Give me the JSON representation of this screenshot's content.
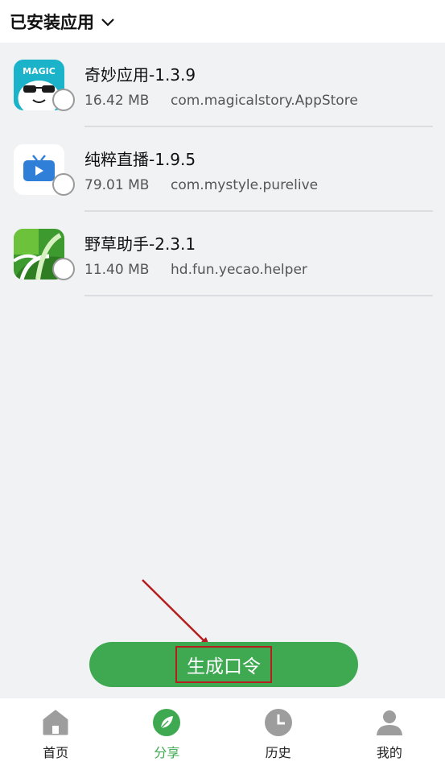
{
  "header": {
    "title": "已安装应用",
    "chevron_icon": "chevron-down-icon"
  },
  "apps": [
    {
      "name": "奇妙应用-1.3.9",
      "size": "16.42 MB",
      "package": "com.magicalstory.AppStore",
      "icon_text": "MAGIC"
    },
    {
      "name": "纯粹直播-1.9.5",
      "size": "79.01 MB",
      "package": "com.mystyle.purelive"
    },
    {
      "name": "野草助手-2.3.1",
      "size": "11.40 MB",
      "package": "hd.fun.yecao.helper"
    }
  ],
  "action": {
    "label": "生成口令"
  },
  "tabs": [
    {
      "label": "首页",
      "icon": "home-icon"
    },
    {
      "label": "分享",
      "icon": "leaf-icon",
      "active": true
    },
    {
      "label": "历史",
      "icon": "clock-icon"
    },
    {
      "label": "我的",
      "icon": "user-icon"
    }
  ],
  "colors": {
    "accent": "#3fa952",
    "highlight": "#b51e1e",
    "background": "#f1f2f4"
  }
}
